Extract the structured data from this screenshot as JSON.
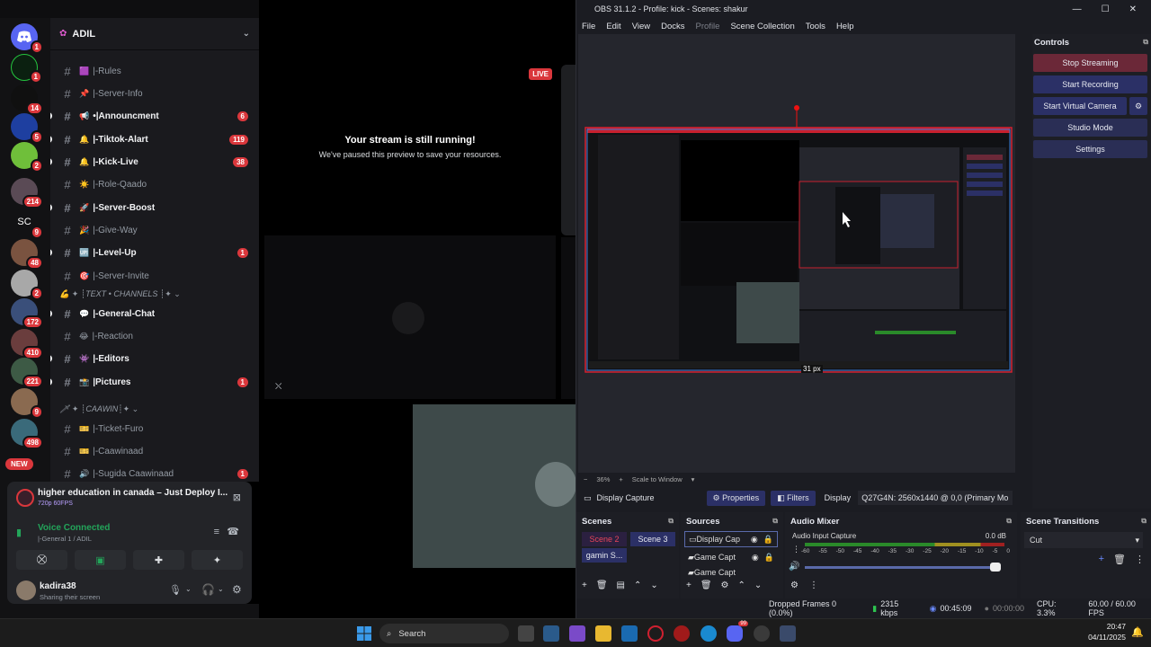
{
  "discord": {
    "server_name": "ADIL",
    "server_badges": [
      "1",
      "1",
      "14",
      "5",
      "2",
      "214",
      "9",
      "48",
      "2",
      "172",
      "410",
      "221",
      "9",
      "498"
    ],
    "rail_text_server": "SC",
    "new_label": "NEW",
    "channels": [
      {
        "emoji": "🟪",
        "name": "|-Rules",
        "bright": false,
        "count": ""
      },
      {
        "emoji": "📌",
        "name": "|-Server-Info",
        "bright": false,
        "count": ""
      },
      {
        "emoji": "📢",
        "name": "•|Announcment",
        "bright": true,
        "count": "6"
      },
      {
        "emoji": "🔔",
        "name": "|-Tiktok-Alart",
        "bright": true,
        "count": "119"
      },
      {
        "emoji": "🔔",
        "name": "|-Kick-Live",
        "bright": true,
        "count": "38"
      },
      {
        "emoji": "☀️",
        "name": "|-Role-Qaado",
        "bright": false,
        "count": ""
      },
      {
        "emoji": "🚀",
        "name": "|-Server-Boost",
        "bright": true,
        "count": ""
      },
      {
        "emoji": "🎉",
        "name": "|-Give-Way",
        "bright": false,
        "count": ""
      },
      {
        "emoji": "🆙",
        "name": "|-Level-Up",
        "bright": true,
        "count": "1"
      },
      {
        "emoji": "🎯",
        "name": "|-Server-Invite",
        "bright": false,
        "count": ""
      }
    ],
    "category_text": "💪 ✦ ┊TEXT • CHANNELS ┊✦ ⌄",
    "channels2": [
      {
        "emoji": "💬",
        "name": "|-General-Chat",
        "bright": true,
        "count": ""
      },
      {
        "emoji": "😂",
        "name": "|-Reaction",
        "bright": false,
        "count": ""
      },
      {
        "emoji": "👾",
        "name": "|-Editors",
        "bright": true,
        "count": ""
      },
      {
        "emoji": "📸",
        "name": "|Pictures",
        "bright": true,
        "count": "1"
      }
    ],
    "category2_text": "🗡 ✦ ┊CAAWIN┊✦ ⌄",
    "channels3": [
      {
        "emoji": "🎫",
        "name": "|-Ticket-Furo",
        "bright": false,
        "count": ""
      },
      {
        "emoji": "🎫",
        "name": "|-Caawinaad",
        "bright": false,
        "count": ""
      },
      {
        "emoji": "🔊",
        "name": "|-Sugida Caawinaad",
        "bright": false,
        "count": "1"
      }
    ],
    "now_playing": {
      "title": "higher education in canada – Just Deploy I...",
      "sub": "720p 60FPS"
    },
    "voice": {
      "status": "Voice Connected",
      "channel": "|-General 1 / ADIL"
    },
    "user": {
      "name": "kadira38",
      "status": "Sharing their screen"
    },
    "stream": {
      "title": "Your stream is still running!",
      "subtitle": "We've paused this preview to save your resources.",
      "live": "LIVE"
    }
  },
  "obs": {
    "title": "OBS 31.1.2 - Profile: kick - Scenes: shakur",
    "menu": [
      "File",
      "Edit",
      "View",
      "Docks",
      "Profile",
      "Scene Collection",
      "Tools",
      "Help"
    ],
    "window_buttons": [
      "—",
      "☐",
      "✕"
    ],
    "controls": {
      "title": "Controls",
      "stop_streaming": "Stop Streaming",
      "start_recording": "Start Recording",
      "start_virtual_camera": "Start Virtual Camera",
      "studio_mode": "Studio Mode",
      "settings": "Settings"
    },
    "zoom": "36%",
    "scale": "Scale to Window",
    "measure": "31 px",
    "source_name": "Display Capture",
    "properties": "Properties",
    "filters": "Filters",
    "display_label": "Display",
    "display_value": "Q27G4N: 2560x1440 @ 0,0 (Primary Mo",
    "scenes_title": "Scenes",
    "scenes": [
      "Scene 2",
      "Scene 3",
      "gamin S..."
    ],
    "sources_title": "Sources",
    "sources": [
      "Display Cap",
      "Game Capt",
      "Game Capt"
    ],
    "mixer_title": "Audio Mixer",
    "mixer_channel": "Audio Input Capture",
    "mixer_db": "0.0 dB",
    "mixer_ticks": [
      "-60",
      "-55",
      "-50",
      "-45",
      "-40",
      "-35",
      "-30",
      "-25",
      "-20",
      "-15",
      "-10",
      "-5",
      "0"
    ],
    "transitions_title": "Scene Transitions",
    "transition": "Cut",
    "status": {
      "dropped": "Dropped Frames 0 (0.0%)",
      "kbps": "2315 kbps",
      "stream_time": "00:45:09",
      "rec_time": "00:00:00",
      "cpu": "CPU: 3.3%",
      "fps": "60.00 / 60.00 FPS"
    }
  },
  "taskbar": {
    "search": "Search",
    "time": "20:47",
    "date": "04/11/2025",
    "notif_badge": "99"
  }
}
